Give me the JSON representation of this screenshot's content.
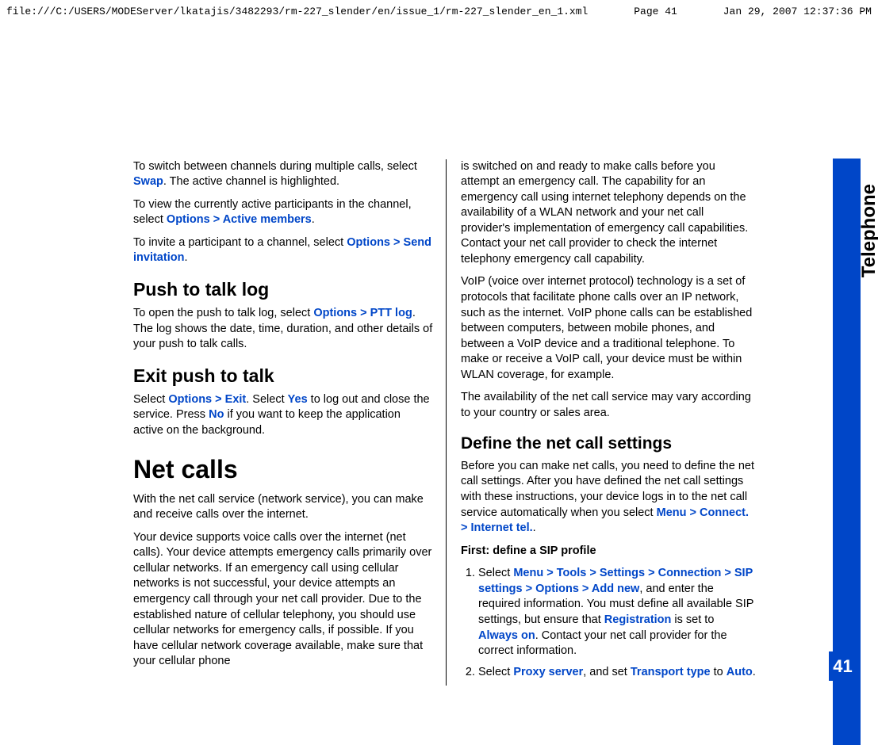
{
  "header": {
    "path": "file:///C:/USERS/MODEServer/lkatajis/3482293/rm-227_slender/en/issue_1/rm-227_slender_en_1.xml",
    "page": "Page 41",
    "timestamp": "Jan 29, 2007 12:37:36 PM"
  },
  "side": {
    "label": "Telephone",
    "page_number": "41"
  },
  "left": {
    "p1a": "To switch between channels during multiple calls, select ",
    "p1_link": "Swap",
    "p1b": ". The active channel is highlighted.",
    "p2a": "To view the currently active participants in the channel, select ",
    "p2_link1": "Options",
    "gt": " > ",
    "p2_link2": "Active members",
    "p2b": ".",
    "p3a": "To invite a participant to a channel, select ",
    "p3_link1": "Options",
    "p3_link2": "Send invitation",
    "p3b": ".",
    "h_ptt": "Push to talk log",
    "p4a": "To open the push to talk log, select ",
    "p4_link1": "Options",
    "p4_link2": "PTT log",
    "p4b": ". The log shows the date, time, duration, and other details of your push to talk calls.",
    "h_exit": "Exit push to talk",
    "p5a": "Select ",
    "p5_link1": "Options",
    "p5_link2": "Exit",
    "p5b": ". Select ",
    "p5_link3": "Yes",
    "p5c": " to log out and close the service. Press ",
    "p5_link4": "No",
    "p5d": " if you want to keep the application active on the background.",
    "h_net": "Net calls",
    "p6": "With the net call service (network service), you can make and receive calls over the internet.",
    "p7": "Your device supports voice calls over the internet (net calls). Your device attempts emergency calls primarily over cellular networks. If an emergency call using cellular networks is not successful, your device attempts an emergency call through your net call provider. Due to the established nature of cellular telephony, you should use cellular networks for emergency calls, if possible. If you have cellular network coverage available, make sure that your cellular phone"
  },
  "right": {
    "p1": "is switched on and ready to make calls before you attempt an emergency call. The capability for an emergency call using internet telephony depends on the availability of a WLAN network and your net call provider's implementation of emergency call capabilities. Contact your net call provider to check the internet telephony emergency call capability.",
    "p2": "VoIP (voice over internet protocol) technology is a set of protocols that facilitate phone calls over an IP network, such as the internet. VoIP phone calls can be established between computers, between mobile phones, and between a VoIP device and a traditional telephone. To make or receive a VoIP call, your device must be within WLAN coverage, for example.",
    "p3": "The availability of the net call service may vary according to your country or sales area.",
    "h_define": "Define the net call settings",
    "p4a": "Before you can make net calls, you need to define the net call settings. After you have defined the net call settings with these instructions, your device logs in to the net call service automatically when you select ",
    "p4_link1": "Menu",
    "gt": " > ",
    "p4_link2": "Connect.",
    "p4_link3": "Internet tel.",
    "p4b": ".",
    "h_first": "First: define a SIP profile",
    "li1a": "Select ",
    "li1_l1": "Menu",
    "li1_l2": "Tools",
    "li1_l3": "Settings",
    "li1_l4": "Connection",
    "li1_l5": "SIP settings",
    "li1_l6": "Options",
    "li1_l7": "Add new",
    "li1b": ", and enter the required information. You must define all available SIP settings, but ensure that ",
    "li1_l8": "Registration",
    "li1c": " is set to ",
    "li1_l9": "Always on",
    "li1d": ". Contact your net call provider for the correct information.",
    "li2a": "Select ",
    "li2_l1": "Proxy server",
    "li2b": ", and set ",
    "li2_l2": "Transport type",
    "li2c": " to ",
    "li2_l3": "Auto",
    "li2d": "."
  }
}
